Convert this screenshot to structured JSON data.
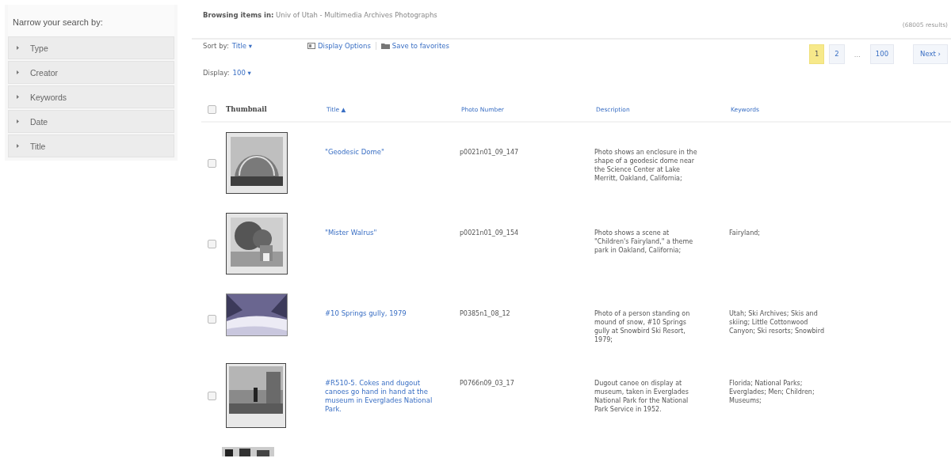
{
  "sidebar": {
    "heading": "Narrow your search by:",
    "facets": [
      {
        "label": "Type",
        "expanded": false
      },
      {
        "label": "Creator",
        "expanded": false
      },
      {
        "label": "Keywords",
        "expanded": false
      },
      {
        "label": "Date",
        "expanded": false
      },
      {
        "label": "Title",
        "expanded": false
      }
    ]
  },
  "header": {
    "browsing": "**Browsing items in:** Univ of Utah - Multimedia Archives Photographs",
    "results": "(68005 results)"
  },
  "toolbar": {
    "sort_label": "Sort by:",
    "sort_value": "Title ▾",
    "display_options": "Display Options",
    "save": "Save to favorites",
    "display_label": "Display:",
    "display_value": "100 ▾"
  },
  "pagination": {
    "pages": [
      {
        "label": "1",
        "selected": true
      },
      {
        "label": "2",
        "selected": false
      },
      {
        "label": "...",
        "kind": "gap"
      },
      {
        "label": "100",
        "selected": false
      }
    ],
    "next": "Next ›"
  },
  "table": {
    "select_all": {
      "checked": false
    },
    "columns": [
      {
        "label": "Thumbnail",
        "kind": "plain"
      },
      {
        "label": "Title ▲",
        "kind": "link"
      },
      {
        "label": "Photo Number",
        "kind": "link"
      },
      {
        "label": "Description",
        "kind": "link"
      },
      {
        "label": "Keywords",
        "kind": "link"
      }
    ],
    "rows": [
      {
        "checked": false,
        "thumbnail": {
          "kind": "picture"
        },
        "title": "\"Geodesic Dome\"",
        "photo_number": "p0021n01_09_147",
        "description": "Photo shows an enclosure in the shape of a geodesic dome near the Science Center at Lake Merritt, Oakland, California;"
      },
      {
        "checked": false,
        "thumbnail": {
          "kind": "picture"
        },
        "title": "\"Mister Walrus\"",
        "photo_number": "p0021n01_09_154",
        "description": "Photo shows a scene at \"Children's Fairyland,\" a theme park in Oakland, California;",
        "keywords": "Fairyland;"
      },
      {
        "checked": false,
        "thumbnail": {
          "kind": "picture"
        },
        "title": "#10 Springs gully, 1979",
        "photo_number": "P0385n1_08_12",
        "description": "Photo of a person standing on mound of snow, #10 Springs gully at Snowbird Ski Resort, 1979;",
        "keywords": "Utah; Ski Archives; Skis and skiing; Little Cottonwood Canyon; Ski resorts; Snowbird"
      },
      {
        "checked": false,
        "thumbnail": {
          "kind": "picture"
        },
        "title": "#R510-5. Cokes and dugout canoes go hand in hand at the museum in Everglades National Park.",
        "photo_number": "P0766n09_03_17",
        "description": "Dugout canoe on display at museum, taken in Everglades National Park for the National Park Service in 1952.",
        "keywords": "Florida; National Parks; Everglades; Men; Children; Museums;"
      },
      {
        "thumbnail": {
          "kind": "picture"
        }
      }
    ]
  }
}
